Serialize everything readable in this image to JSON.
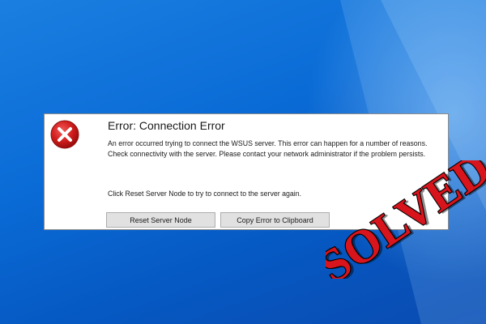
{
  "dialog": {
    "title": "Error: Connection Error",
    "message": "An error occurred trying to connect the WSUS server. This error can happen for a number of reasons. Check connectivity with the server. Please contact your network administrator if the problem persists.",
    "hint": "Click Reset Server Node to try to connect to the server again.",
    "buttons": {
      "reset": "Reset Server Node",
      "copy": "Copy Error to Clipboard"
    }
  },
  "stamp": {
    "text": "SOLVED"
  },
  "colors": {
    "desktop": "#0a6bd6",
    "error_red": "#c8102e",
    "stamp_red": "#d8141c"
  },
  "icons": {
    "dialog_icon": "error-x-icon"
  }
}
